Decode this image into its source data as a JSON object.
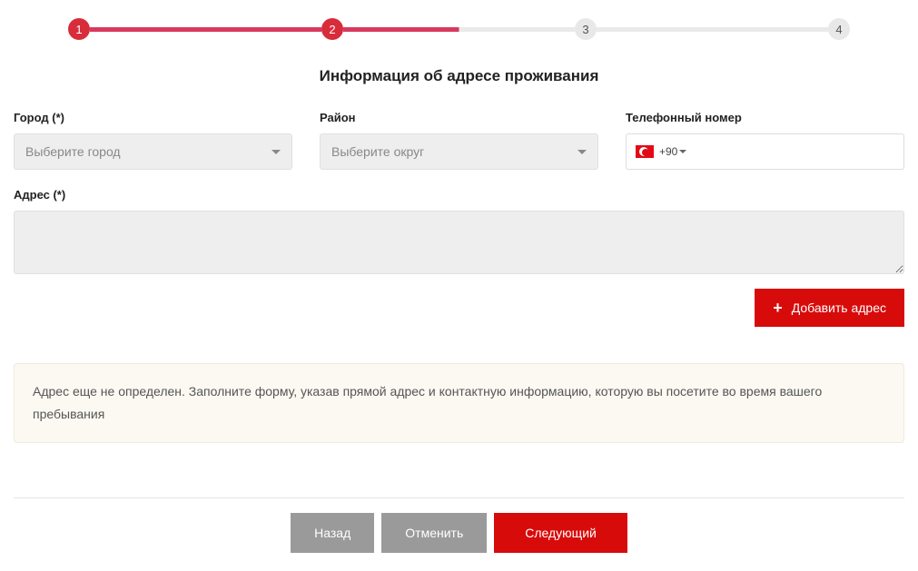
{
  "stepper": {
    "steps": [
      "1",
      "2",
      "3",
      "4"
    ]
  },
  "title": "Информация об адресе проживания",
  "fields": {
    "city": {
      "label": "Город (*)",
      "placeholder": "Выберите город"
    },
    "district": {
      "label": "Район",
      "placeholder": "Выберите округ"
    },
    "phone": {
      "label": "Телефонный номер",
      "code": "+90"
    },
    "address": {
      "label": "Адрес (*)"
    }
  },
  "buttons": {
    "add_address": "Добавить адрес",
    "back": "Назад",
    "cancel": "Отменить",
    "next": "Следующий"
  },
  "alert": "Адрес еще не определен. Заполните форму, указав прямой адрес и контактную информацию, которую вы посетите во время вашего пребывания"
}
